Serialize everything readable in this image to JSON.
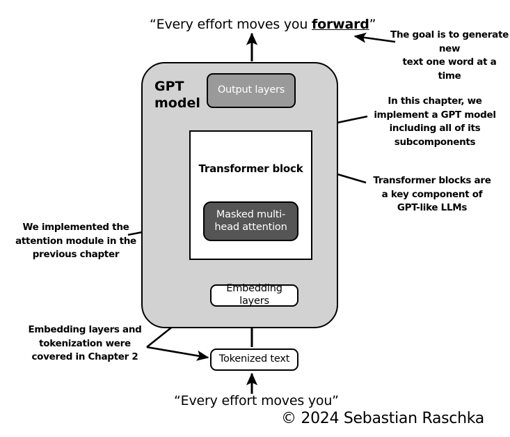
{
  "figure": {
    "top_quote_prefix": "“Every effort moves you ",
    "top_quote_emphasis": "forward",
    "top_quote_suffix": "”",
    "bottom_quote": "“Every effort moves you”",
    "copyright": "© 2024 Sebastian Raschka"
  },
  "gpt_model": {
    "label_line1": "GPT",
    "label_line2": "model",
    "fill_color": "#d2d2d2",
    "border_color": "#000000"
  },
  "nodes": {
    "output_layers": {
      "label": "Output layers",
      "fill_color": "#9a9a9a",
      "text_color": "#ffffff"
    },
    "transformer_block": {
      "label": "Transformer block",
      "fill_color": "#ffffff",
      "text_color": "#000000"
    },
    "masked_attention": {
      "label": "Masked multi-head attention",
      "fill_color": "#555555",
      "text_color": "#ffffff"
    },
    "embedding_layers": {
      "label": "Embedding layers",
      "fill_color": "#ffffff",
      "text_color": "#000000"
    },
    "tokenized_text": {
      "label": "Tokenized text",
      "fill_color": "#ffffff",
      "text_color": "#000000"
    }
  },
  "annotations": {
    "goal": {
      "line1": "The goal is to generate new",
      "line2": "text one word at a time"
    },
    "chapter_scope": {
      "line1": "In this chapter, we",
      "line2": "implement a GPT model",
      "line3": "including all of its",
      "line4": "subcomponents"
    },
    "transformer_key": {
      "line1": "Transformer blocks are",
      "line2": "a key component of",
      "line3": "GPT-like LLMs"
    },
    "attention_prev": {
      "line1": "We implemented the",
      "line2": "attention module in the",
      "line3": "previous chapter"
    },
    "embedding_ch2": {
      "line1": "Embedding layers and",
      "line2": "tokenization were",
      "line3": "covered in Chapter 2"
    }
  }
}
